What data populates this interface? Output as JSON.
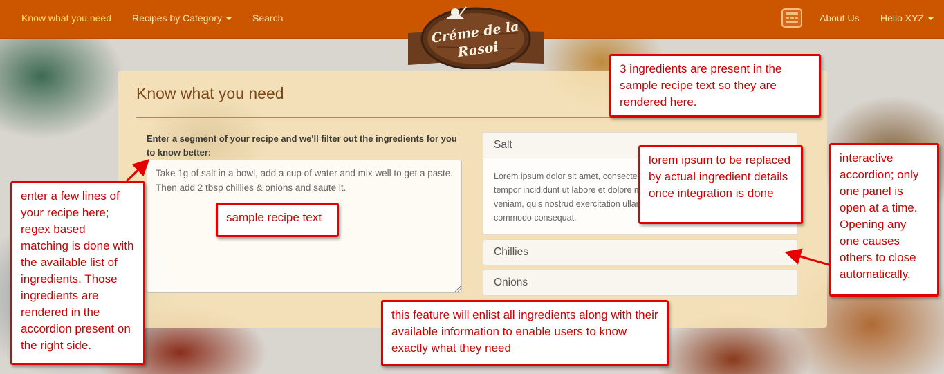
{
  "nav": {
    "left_links": [
      "Know what you need",
      "Recipes by Category",
      "Search"
    ],
    "right_links": [
      "About Us",
      "Hello XYZ"
    ],
    "logo_line1": "Créme de la",
    "logo_line2": "Rasoi",
    "icon": "calendar-grid-icon"
  },
  "panel": {
    "title": "Know what you need",
    "prompt": "Enter a segment of your recipe and we'll filter out the ingredients for you to know better:",
    "recipe_text": "Take 1g of salt in a bowl, add a cup of water and mix well to get a paste. Then add 2 tbsp chillies & onions and saute it."
  },
  "accordion": {
    "items": [
      {
        "label": "Salt",
        "body": "Lorem ipsum dolor sit amet, consectetur adipiscing elit, sed do eiusmod tempor incididunt ut labore et dolore magna aliqua. Ut enim ad minim veniam, quis nostrud exercitation ullamco laboris nisi ut aliquip ex ea commodo consequat."
      },
      {
        "label": "Chillies"
      },
      {
        "label": "Onions"
      }
    ]
  },
  "annotations": {
    "ingredients_found": "3 ingredients are present in the sample recipe text so they are rendered here.",
    "enter_recipe": "enter a few lines of your recipe here; regex based matching is done with the available list of ingredients. Those ingredients are rendered in the accordion present on the right side.",
    "sample_text": "sample recipe text",
    "lorem": "lorem ipsum to be replaced by actual ingredient details once integration is done",
    "accordion": "interactive accordion; only one panel is open at a time. Opening any one causes others to close automatically.",
    "feature": "this feature will enlist all ingredients along with their available information to enable users to know exactly what they need"
  },
  "colors": {
    "navbar": "#cc5500",
    "annotation_border": "#e30000",
    "annotation_text": "#cc0000",
    "panel_title": "#7a4a1a"
  }
}
